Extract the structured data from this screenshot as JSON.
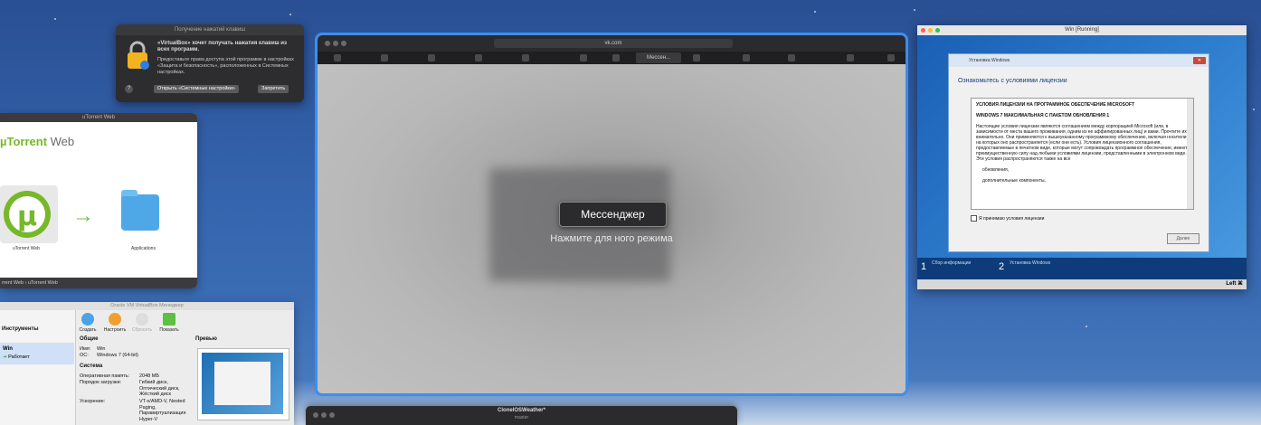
{
  "keyboard_dialog": {
    "title": "Получение нажатий клавиш",
    "message": "«VirtualBox» хочет получать нажатия клавиш из всех программ.",
    "detail": "Предоставьте права доступа этой программе в настройках «Защита и безопасность», расположенных в Системных настройках.",
    "open_settings": "Открыть «Системные настройки»",
    "deny": "Запретить",
    "help": "?"
  },
  "utorrent": {
    "title": "uTorrent Web",
    "logo_mu": "µTorrent",
    "logo_web": " Web",
    "app_label": "uTorrent Web",
    "folder_label": "Applications",
    "path": "rrent Web › uTorrent Web"
  },
  "vbox_manager": {
    "title": "Oracle VM VirtualBox Менеджер",
    "tools": "Инструменты",
    "vm_name": "Win",
    "vm_state": "Работает",
    "toolbar": [
      "Создать",
      "Настроить",
      "Сбросить",
      "Показать"
    ],
    "general_title": "Общие",
    "name_label": "Имя:",
    "name_value": "Win",
    "os_label": "ОС:",
    "os_value": "Windows 7 (64-bit)",
    "system_title": "Система",
    "ram_label": "Оперативная память:",
    "ram_value": "2048 МБ",
    "boot_label": "Порядок загрузки:",
    "boot_value": "Гибкий диск, Оптический диск, Жёсткий диск",
    "accel_label": "Ускорение:",
    "accel_value": "VT-x/AMD-V, Nested Paging, Паравиртуализация Hyper-V",
    "preview_title": "Превью"
  },
  "safari": {
    "url": "vk.com",
    "tab_current": "Мессен...",
    "hint": "Нажмите для                              ного режима",
    "tooltip": "Мессенджер"
  },
  "win_vm": {
    "title": "Win [Running]",
    "dialog_title": "Установка Windows",
    "heading": "Ознакомьтесь с условиями лицензии",
    "license_h1": "УСЛОВИЯ ЛИЦЕНЗИИ НА ПРОГРАММНОЕ ОБЕСПЕЧЕНИЕ MICROSOFT",
    "license_h2": "WINDOWS 7 МАКСИМАЛЬНАЯ С ПАКЕТОМ ОБНОВЛЕНИЯ 1",
    "license_body": "Настоящие условия лицензии являются соглашением между корпорацией Microsoft (или, в зависимости от места вашего проживания, одним из ее аффилированных лиц) и вами. Прочтите их внимательно. Они применяются к вышеуказанному программному обеспечению, включая носители, на которых оно распространяется (если они есть). Условия лицензионного соглашения, предоставляемые в печатном виде, которые могут сопровождать программное обеспечение, имеют преимущественную силу над любыми условиями лицензии, представленными в электронном виде. Эти условия распространяются также на все",
    "bullet1": "обновления,",
    "bullet2": "дополнительные компоненты,",
    "accept": "Я принимаю условия лицензии",
    "next": "Далее",
    "step1_num": "1",
    "step1_label": "Сбор информации",
    "step2_num": "2",
    "step2_label": "Установка Windows",
    "status_key": "Left ⌘"
  },
  "bottom_window": {
    "title": "CloneIOSWeather*",
    "subtitle": "master"
  }
}
